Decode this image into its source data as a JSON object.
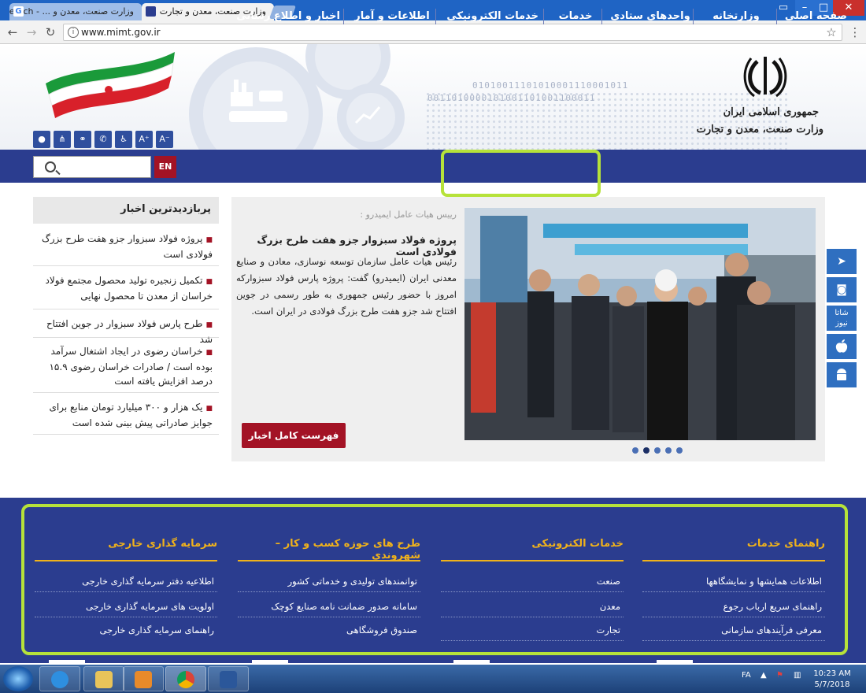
{
  "browser": {
    "tabs": [
      {
        "title": "وزارت صنعت، معدن و ... - earch",
        "active": false
      },
      {
        "title": "وزارت صنعت، معدن و تجارت",
        "active": true
      }
    ],
    "url": "www.mimt.gov.ir"
  },
  "header": {
    "gov_line1": "جمهوری اسلامی ایران",
    "gov_line2": "وزارت صنعت، معدن و تجارت",
    "binary_text_1": "01010011101010001110001011",
    "binary_text_2": "0011010000101001101001100011",
    "icons": [
      "a-minus-icon",
      "a-plus-icon",
      "accessibility-icon",
      "phone-icon",
      "link-icon",
      "sitemap-icon",
      "user-icon"
    ],
    "font_small": "A⁻",
    "font_large": "A⁺"
  },
  "nav": {
    "items": [
      "صفحه اصلی",
      "وزارتخانه",
      "واحدهای ستادی",
      "خدمات",
      "خدمات الکترونیکی",
      "اطلاعات و آمار",
      "اخبار و اطلاع رسانی"
    ],
    "lang_button": "EN",
    "highlight_color": "#b6e23a"
  },
  "most_viewed": {
    "title": "پربازدیدترین اخبار",
    "items": [
      "پروژه فولاد سبزوار جزو هفت طرح بزرگ فولادی است",
      "تکمیل زنجیره تولید محصول مجتمع فولاد خراسان از معدن تا محصول نهایی",
      "طرح پارس فولاد سبزوار در جوین افتتاح شد",
      "خراسان رضوی در ایجاد اشتغال سرآمد بوده است / صادرات خراسان رضوی ۱۵.۹ درصد افزایش یافته است",
      "یک هزار و ۳۰۰ میلیارد تومان منابع برای جوایز صادراتی پیش بینی شده است"
    ]
  },
  "featured": {
    "kicker": "رییس هیات عامل ایمیدرو :",
    "title": "پروژه فولاد سبزوار جزو هفت طرح بزرگ فولادی است",
    "body": "رئیس هیات عامل سازمان توسعه نوسازی، معادن و صنایع معدنی ایران (ایمیدرو) گفت: پروژه پارس فولاد سبزوارکه امروز با حضور رئیس جمهوری به طور رسمی در جوین افتتاح شد جزو هفت طرح بزرگ فولادی در ایران است.",
    "button": "فهرست کامل اخبار",
    "slides": 5,
    "active_slide": 2
  },
  "side_buttons": [
    {
      "name": "telegram-icon",
      "glyph": "➤"
    },
    {
      "name": "instagram-icon",
      "glyph": "◙"
    },
    {
      "name": "shatanews-icon",
      "glyph": "شاتا\nنیوز"
    },
    {
      "name": "apple-icon",
      "glyph": ""
    },
    {
      "name": "android-icon",
      "glyph": "▣"
    }
  ],
  "footer": {
    "columns": [
      {
        "title": "راهنمای خدمات",
        "links": [
          "اطلاعات همایشها و نمایشگاهها",
          "راهنمای سریع ارباب رجوع",
          "معرفی فرآیندهای سازمانی"
        ]
      },
      {
        "title": "خدمات الکترونیکی",
        "links": [
          "صنعت",
          "معدن",
          "تجارت"
        ]
      },
      {
        "title": "طرح های حوزه کسب و کار – شهروندی",
        "links": [
          "توانمندهای تولیدی و خدماتی کشور",
          "سامانه صدور ضمانت نامه صنایع کوچک",
          "صندوق فروشگاهی"
        ]
      },
      {
        "title": "سرمایه گذاری خارجی",
        "links": [
          "اطلاعیه دفتر سرمایه گذاری خارجی",
          "اولویت های سرمایه گذاری خارجی",
          "راهنمای سرمایه گذاری خارجی"
        ]
      }
    ],
    "accent_color": "#f0b21b"
  },
  "taskbar": {
    "lang": "FA",
    "time": "10:23 AM",
    "date": "5/7/2018"
  }
}
